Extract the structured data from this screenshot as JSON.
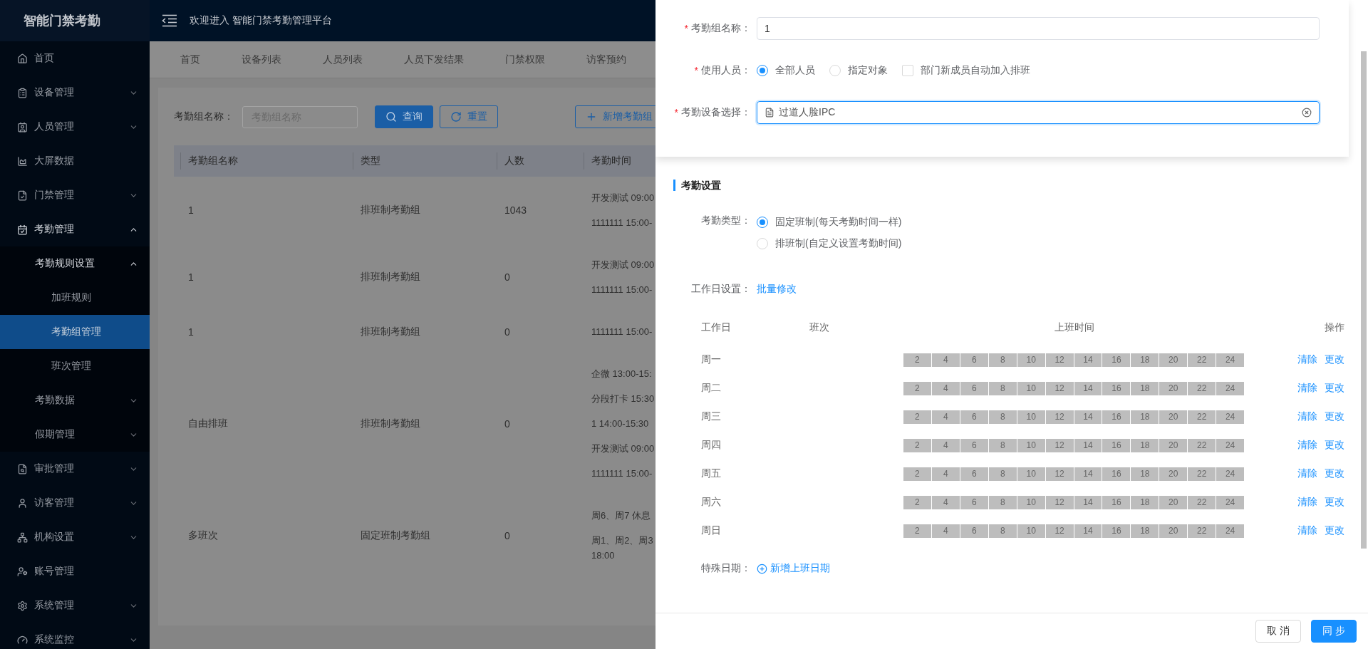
{
  "sidebar": {
    "logo": "智能门禁考勤",
    "items": [
      {
        "label": "首页",
        "selected": false
      },
      {
        "label": "设备管理",
        "selected": false,
        "expanded": false
      },
      {
        "label": "人员管理",
        "selected": false,
        "expanded": false
      },
      {
        "label": "大屏数据",
        "selected": false
      },
      {
        "label": "门禁管理",
        "selected": false,
        "expanded": false
      },
      {
        "label": "考勤管理",
        "selected": false,
        "expanded": true,
        "children": [
          {
            "label": "考勤规则设置",
            "selected": false,
            "expanded": true,
            "children": [
              {
                "label": "加班规则",
                "selected": false
              },
              {
                "label": "考勤组管理",
                "selected": true
              },
              {
                "label": "班次管理",
                "selected": false
              }
            ]
          },
          {
            "label": "考勤数据",
            "selected": false,
            "expanded": false
          },
          {
            "label": "假期管理",
            "selected": false,
            "expanded": false
          }
        ]
      },
      {
        "label": "审批管理",
        "selected": false,
        "expanded": false
      },
      {
        "label": "访客管理",
        "selected": false,
        "expanded": false
      },
      {
        "label": "机构设置",
        "selected": false,
        "expanded": false
      },
      {
        "label": "账号管理",
        "selected": false
      },
      {
        "label": "系统管理",
        "selected": false,
        "expanded": false
      },
      {
        "label": "系统监控",
        "selected": false,
        "expanded": false
      }
    ]
  },
  "header": {
    "title": "欢迎进入 智能门禁考勤管理平台"
  },
  "tabs": [
    {
      "label": "首页",
      "selected": false
    },
    {
      "label": "设备列表",
      "selected": false
    },
    {
      "label": "人员列表",
      "selected": false
    },
    {
      "label": "人员下发结果",
      "selected": false
    },
    {
      "label": "门禁权限",
      "selected": false
    },
    {
      "label": "访客预约",
      "selected": false
    }
  ],
  "search": {
    "label": "考勤组名称：",
    "placeholder": "考勤组名称",
    "buttons": [
      {
        "label": "查询",
        "kind": "primary"
      },
      {
        "label": "重置",
        "kind": "outline"
      },
      {
        "label": "新增考勤组",
        "kind": "outline"
      }
    ]
  },
  "table": {
    "columns": [
      "考勤组名称",
      "类型",
      "人数",
      "考勤时间"
    ],
    "rows": [
      {
        "name": "1",
        "type": "排班制考勤组",
        "count": "1043",
        "times": [
          [
            "开发测试 09:00"
          ],
          [
            "1111111 15:00-"
          ]
        ]
      },
      {
        "name": "1",
        "type": "排班制考勤组",
        "count": "0",
        "times": [
          [
            "开发测试 09:00"
          ],
          [
            "1111111 15:00-"
          ]
        ]
      },
      {
        "name": "1",
        "type": "排班制考勤组",
        "count": "0",
        "times": [
          [
            "1111111 15:00-"
          ]
        ]
      },
      {
        "name": "自由排班",
        "type": "排班制考勤组",
        "count": "0",
        "times": [
          [
            "企微 13:00-15:"
          ],
          [
            "分段打卡 15:30"
          ],
          [
            "1 14:00-15:30"
          ],
          [
            "开发测试 09:00"
          ],
          [
            "1111111 15:00-"
          ]
        ]
      },
      {
        "name": "多班次",
        "type": "固定班制考勤组",
        "count": "0",
        "times": [
          [
            "周6、周7 休息"
          ],
          [
            "周1、周2、周3",
            "18:00"
          ]
        ]
      }
    ]
  },
  "drawer": {
    "name_field": {
      "required_mark": "*",
      "label": "考勤组名称：",
      "value": "1"
    },
    "users": {
      "required_mark": "*",
      "label": "使用人员：",
      "options": [
        {
          "label": "全部人员",
          "selected": true
        },
        {
          "label": "指定对象",
          "selected": false
        }
      ],
      "checkbox": {
        "label": "部门新成员自动加入排班",
        "checked": false
      }
    },
    "device": {
      "required_mark": "*",
      "label": "考勤设备选择：",
      "tag": "过道人脸IPC",
      "focused": true
    },
    "section_title": "考勤设置",
    "type": {
      "label": "考勤类型：",
      "options": [
        {
          "label": "固定班制(每天考勤时间一样)",
          "selected": true
        },
        {
          "label": "排班制(自定义设置考勤时间)",
          "selected": false
        }
      ]
    },
    "workday": {
      "label": "工作日设置：",
      "link": "批量修改"
    },
    "schedule": {
      "columns": [
        "工作日",
        "班次",
        "上班时间",
        "操作"
      ],
      "rows": [
        {
          "day": "周一",
          "hours": [
            "2",
            "4",
            "6",
            "8",
            "10",
            "12",
            "14",
            "16",
            "18",
            "20",
            "22",
            "24"
          ],
          "actions": [
            "清除",
            "更改"
          ]
        },
        {
          "day": "周二",
          "hours": [
            "2",
            "4",
            "6",
            "8",
            "10",
            "12",
            "14",
            "16",
            "18",
            "20",
            "22",
            "24"
          ],
          "actions": [
            "清除",
            "更改"
          ]
        },
        {
          "day": "周三",
          "hours": [
            "2",
            "4",
            "6",
            "8",
            "10",
            "12",
            "14",
            "16",
            "18",
            "20",
            "22",
            "24"
          ],
          "actions": [
            "清除",
            "更改"
          ]
        },
        {
          "day": "周四",
          "hours": [
            "2",
            "4",
            "6",
            "8",
            "10",
            "12",
            "14",
            "16",
            "18",
            "20",
            "22",
            "24"
          ],
          "actions": [
            "清除",
            "更改"
          ]
        },
        {
          "day": "周五",
          "hours": [
            "2",
            "4",
            "6",
            "8",
            "10",
            "12",
            "14",
            "16",
            "18",
            "20",
            "22",
            "24"
          ],
          "actions": [
            "清除",
            "更改"
          ]
        },
        {
          "day": "周六",
          "hours": [
            "2",
            "4",
            "6",
            "8",
            "10",
            "12",
            "14",
            "16",
            "18",
            "20",
            "22",
            "24"
          ],
          "actions": [
            "清除",
            "更改"
          ]
        },
        {
          "day": "周日",
          "hours": [
            "2",
            "4",
            "6",
            "8",
            "10",
            "12",
            "14",
            "16",
            "18",
            "20",
            "22",
            "24"
          ],
          "actions": [
            "清除",
            "更改"
          ]
        }
      ]
    },
    "special": {
      "label": "特殊日期：",
      "link": "新增上班日期"
    },
    "buttons": [
      {
        "label": "取 消",
        "kind": "default"
      },
      {
        "label": "同 步",
        "kind": "primary"
      }
    ]
  }
}
